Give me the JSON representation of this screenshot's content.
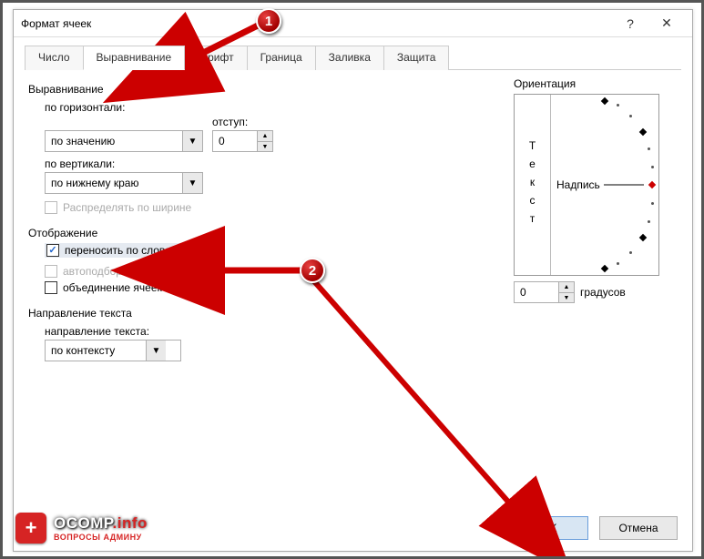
{
  "dialog": {
    "title": "Формат ячеек",
    "help_char": "?",
    "close_char": "✕"
  },
  "tabs": [
    {
      "label": "Число"
    },
    {
      "label": "Выравнивание"
    },
    {
      "label": "Шрифт"
    },
    {
      "label": "Граница"
    },
    {
      "label": "Заливка"
    },
    {
      "label": "Защита"
    }
  ],
  "align": {
    "group": "Выравнивание",
    "horiz_label": "по горизонтали:",
    "horiz_value": "по значению",
    "indent_label": "отступ:",
    "indent_value": "0",
    "vert_label": "по вертикали:",
    "vert_value": "по нижнему краю",
    "justify_label": "Распределять по ширине"
  },
  "display": {
    "group": "Отображение",
    "wrap_label": "переносить по словам",
    "shrink_label": "автоподбор ширины",
    "merge_label": "объединение ячеек"
  },
  "textdir": {
    "group": "Направление текста",
    "dir_label": "направление текста:",
    "dir_value": "по контексту"
  },
  "orient": {
    "group": "Ориентация",
    "vtext": "Текст",
    "label": "Надпись",
    "deg_value": "0",
    "deg_unit": "градусов"
  },
  "buttons": {
    "ok": "OK",
    "cancel": "Отмена"
  },
  "annotations": {
    "m1": "1",
    "m2": "2"
  },
  "watermark": {
    "badge": "+",
    "name": "OCOMP",
    "suffix": ".info",
    "tagline": "ВОПРОСЫ АДМИНУ"
  }
}
